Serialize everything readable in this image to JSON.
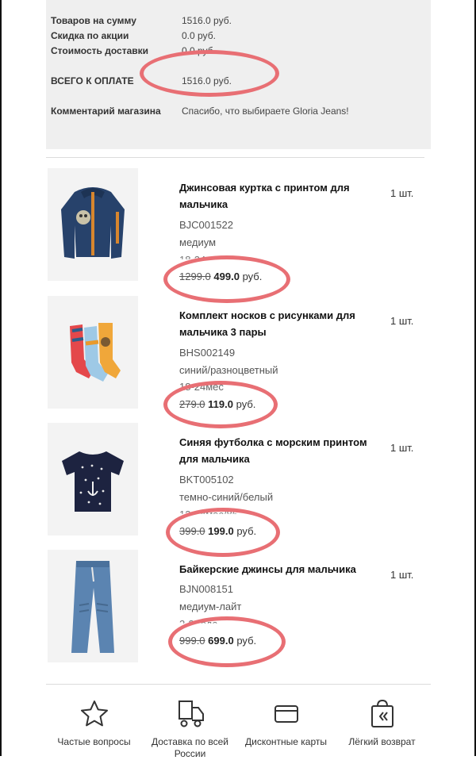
{
  "summary": {
    "items_total": {
      "label": "Товаров на сумму",
      "value": "1516.0 руб."
    },
    "discount": {
      "label": "Скидка по акции",
      "value": "0.0 руб."
    },
    "delivery": {
      "label": "Стоимость доставки",
      "value": "0.0 руб."
    },
    "grand_total": {
      "label": "ВСЕГО К ОПЛАТЕ",
      "value": "1516.0 руб."
    },
    "comment": {
      "label": "Комментарий магазина",
      "value": "Спасибо, что выбираете Gloria Jeans!"
    }
  },
  "products": [
    {
      "title": "Джинсовая куртка с принтом для мальчика",
      "sku": "BJC001522",
      "color": "медиум",
      "size": "18-24мес/92",
      "old_price": "1299.0",
      "new_price": "499.0",
      "currency": "руб.",
      "qty": "1 шт."
    },
    {
      "title": "Комплект носков с рисунками для мальчика 3 пары",
      "sku": "BHS002149",
      "color": "синий/разноцветный",
      "size": "18-24мес",
      "old_price": "279.0",
      "new_price": "119.0",
      "currency": "руб.",
      "qty": "1 шт."
    },
    {
      "title": "Синяя футболка с морским принтом для мальчика",
      "sku": "BKT005102",
      "color": "темно-синий/белый",
      "size": "12-18мес/86",
      "old_price": "399.0",
      "new_price": "199.0",
      "currency": "руб.",
      "qty": "1 шт."
    },
    {
      "title": "Байкерские джинсы для мальчика",
      "sku": "BJN008151",
      "color": "медиум-лайт",
      "size": "2-3 года",
      "old_price": "999.0",
      "new_price": "699.0",
      "currency": "руб.",
      "qty": "1 шт."
    }
  ],
  "nav": [
    {
      "label": "Частые вопросы",
      "icon": "star-icon"
    },
    {
      "label": "Доставка по всей России",
      "icon": "truck-icon"
    },
    {
      "label": "Дисконтные карты",
      "icon": "card-icon"
    },
    {
      "label": "Лёгкий возврат",
      "icon": "return-bag-icon"
    }
  ],
  "colors": {
    "annotation": "#e86f74",
    "summary_bg": "#efefef"
  }
}
